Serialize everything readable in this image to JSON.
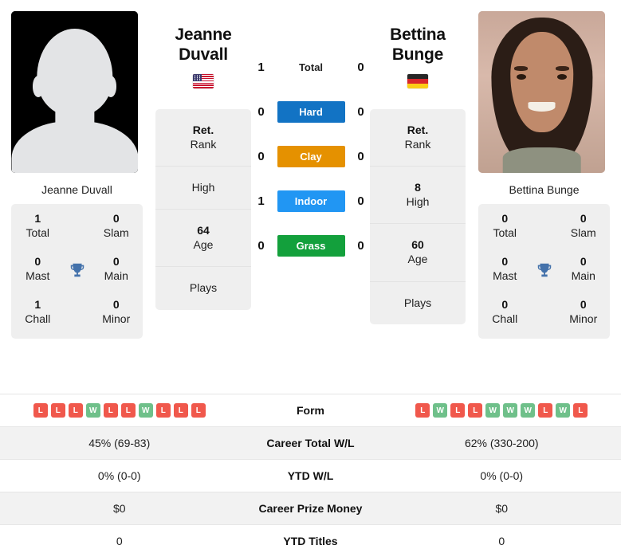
{
  "players": {
    "left": {
      "first_name": "Jeanne",
      "last_name": "Duvall",
      "full_name": "Jeanne Duvall",
      "country": "US",
      "flag_icon": "flag-us-icon",
      "photo_type": "placeholder-avatar",
      "titles": {
        "total": "1",
        "total_label": "Total",
        "slam": "0",
        "slam_label": "Slam",
        "mast": "0",
        "mast_label": "Mast",
        "main": "0",
        "main_label": "Main",
        "chall": "1",
        "chall_label": "Chall",
        "minor": "0",
        "minor_label": "Minor",
        "trophy_icon": "trophy-icon"
      },
      "info": {
        "rank_value": "Ret.",
        "rank_label": "Rank",
        "high_value": "",
        "high_label": "High",
        "age_value": "64",
        "age_label": "Age",
        "plays_value": "",
        "plays_label": "Plays"
      },
      "surface_scores": {
        "total": "1",
        "hard": "0",
        "clay": "0",
        "indoor": "1",
        "grass": "0"
      },
      "form": [
        "L",
        "L",
        "L",
        "W",
        "L",
        "L",
        "W",
        "L",
        "L",
        "L"
      ],
      "career_total_wl": "45% (69-83)",
      "ytd_wl": "0% (0-0)",
      "career_prize_money": "$0",
      "ytd_titles": "0"
    },
    "right": {
      "first_name": "Bettina",
      "last_name": "Bunge",
      "full_name": "Bettina Bunge",
      "country": "DE",
      "flag_icon": "flag-de-icon",
      "photo_type": "portrait-photo",
      "titles": {
        "total": "0",
        "total_label": "Total",
        "slam": "0",
        "slam_label": "Slam",
        "mast": "0",
        "mast_label": "Mast",
        "main": "0",
        "main_label": "Main",
        "chall": "0",
        "chall_label": "Chall",
        "minor": "0",
        "minor_label": "Minor",
        "trophy_icon": "trophy-icon"
      },
      "info": {
        "rank_value": "Ret.",
        "rank_label": "Rank",
        "high_value": "8",
        "high_label": "High",
        "age_value": "60",
        "age_label": "Age",
        "plays_value": "",
        "plays_label": "Plays"
      },
      "surface_scores": {
        "total": "0",
        "hard": "0",
        "clay": "0",
        "indoor": "0",
        "grass": "0"
      },
      "form": [
        "L",
        "W",
        "L",
        "L",
        "W",
        "W",
        "W",
        "L",
        "W",
        "L"
      ],
      "career_total_wl": "62% (330-200)",
      "ytd_wl": "0% (0-0)",
      "career_prize_money": "$0",
      "ytd_titles": "0"
    }
  },
  "surfaces": [
    {
      "key": "total",
      "label": "Total",
      "color": "transparent",
      "text_color": "#222222"
    },
    {
      "key": "hard",
      "label": "Hard",
      "color": "#1273c4",
      "text_color": "#ffffff"
    },
    {
      "key": "clay",
      "label": "Clay",
      "color": "#e59100",
      "text_color": "#ffffff"
    },
    {
      "key": "indoor",
      "label": "Indoor",
      "color": "#2196f3",
      "text_color": "#ffffff"
    },
    {
      "key": "grass",
      "label": "Grass",
      "color": "#13a03c",
      "text_color": "#ffffff"
    }
  ],
  "comparison_rows": [
    {
      "label": "Form",
      "type": "form"
    },
    {
      "label": "Career Total W/L",
      "type": "text",
      "key": "career_total_wl"
    },
    {
      "label": "YTD W/L",
      "type": "text",
      "key": "ytd_wl"
    },
    {
      "label": "Career Prize Money",
      "type": "text",
      "key": "career_prize_money"
    },
    {
      "label": "YTD Titles",
      "type": "text",
      "key": "ytd_titles"
    }
  ],
  "colors": {
    "win_badge": "#6fc08a",
    "loss_badge": "#f0584c",
    "card_bg": "#efefef",
    "alt_row_bg": "#f2f2f2",
    "trophy": "#4472ab"
  }
}
